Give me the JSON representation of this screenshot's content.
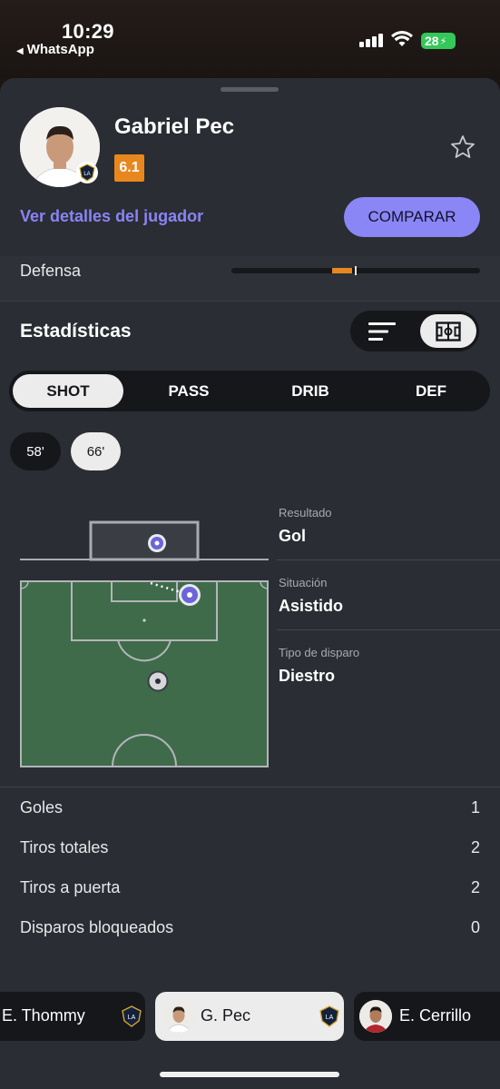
{
  "status_bar": {
    "time": "10:29",
    "back_app": "WhatsApp",
    "battery": "28"
  },
  "player": {
    "name": "Gabriel Pec",
    "rating": "6.1",
    "rating_color": "#e8871e",
    "details_link": "Ver detalles del jugador",
    "compare_label": "COMPARAR",
    "club_badge": "LA"
  },
  "defense": {
    "label": "Defensa"
  },
  "stats_section": {
    "title": "Estadísticas",
    "view_options": [
      "list-icon",
      "pitch-icon"
    ],
    "selected_view": "pitch-icon"
  },
  "category_tabs": [
    {
      "label": "SHOT",
      "active": true
    },
    {
      "label": "PASS",
      "active": false
    },
    {
      "label": "DRIB",
      "active": false
    },
    {
      "label": "DEF",
      "active": false
    }
  ],
  "minutes": [
    {
      "label": "58'",
      "active": false
    },
    {
      "label": "66'",
      "active": true
    }
  ],
  "shot_info": {
    "result_label": "Resultado",
    "result_value": "Gol",
    "situation_label": "Situación",
    "situation_value": "Asistido",
    "shot_type_label": "Tipo de disparo",
    "shot_type_value": "Diestro"
  },
  "shot_stats": [
    {
      "label": "Goles",
      "value": "1"
    },
    {
      "label": "Tiros totales",
      "value": "2"
    },
    {
      "label": "Tiros a puerta",
      "value": "2"
    },
    {
      "label": "Disparos bloqueados",
      "value": "0"
    }
  ],
  "bottom_players": [
    {
      "name": "E. Thommy",
      "active": false
    },
    {
      "name": "G. Pec",
      "active": true
    },
    {
      "name": "E. Cerrillo",
      "active": false
    }
  ],
  "colors": {
    "accent": "#8b86f6",
    "pitch": "#3f6b4a",
    "sheet": "#2a2d33"
  }
}
